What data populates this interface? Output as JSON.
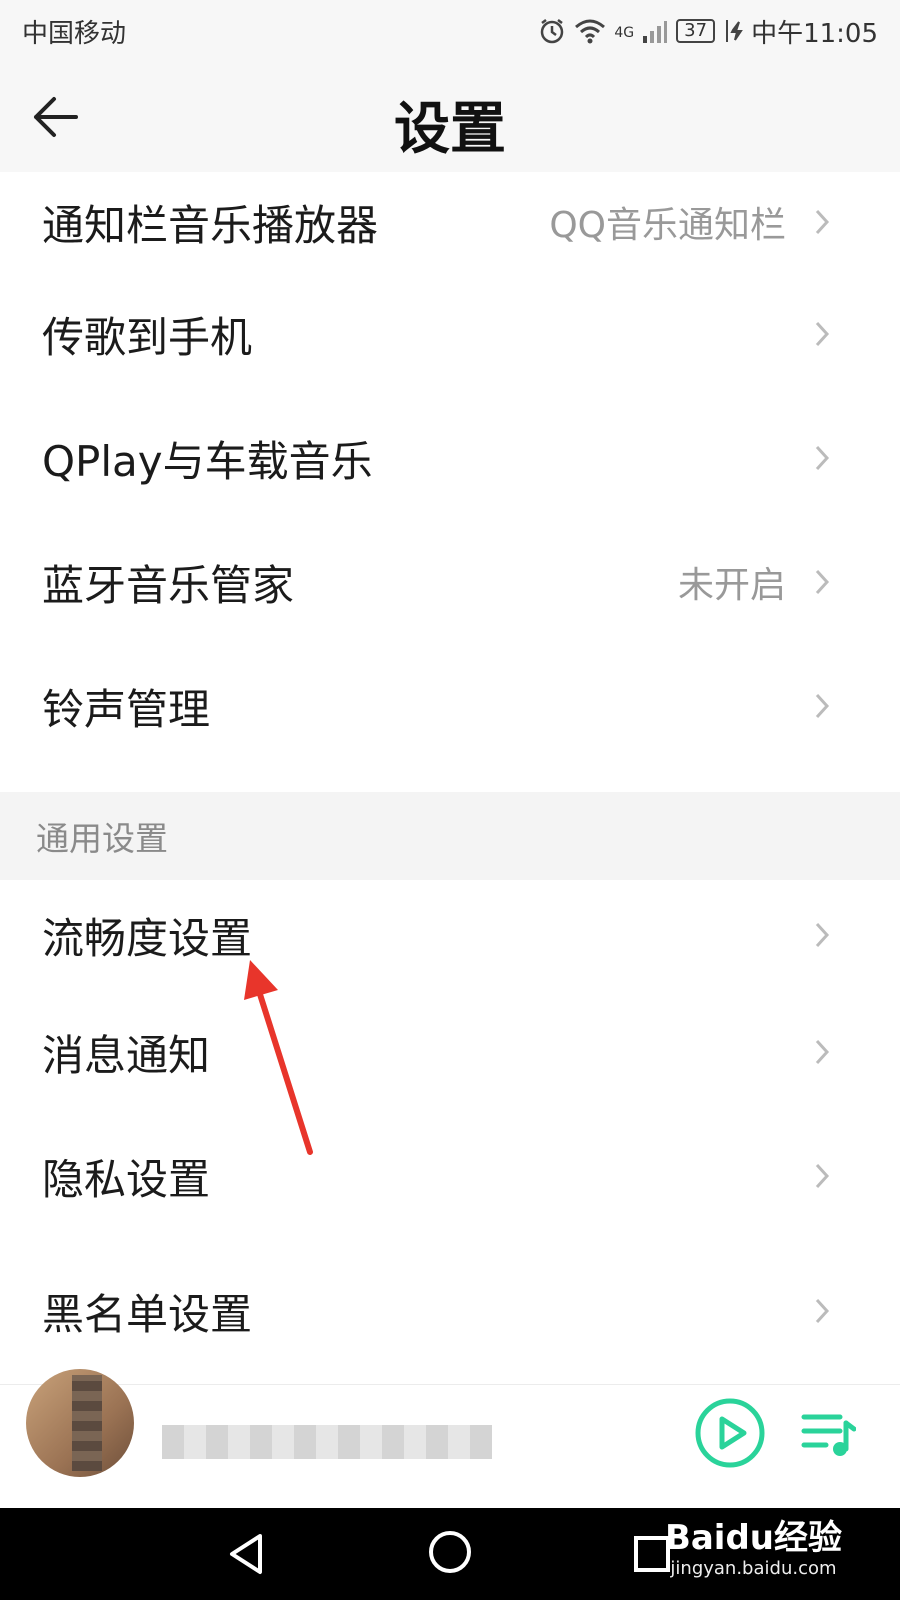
{
  "status_bar": {
    "carrier": "中国移动",
    "network": "4G",
    "battery": "37",
    "time": "中午11:05"
  },
  "header": {
    "title": "设置",
    "back_icon": "back-arrow-icon"
  },
  "list_top": [
    {
      "label": "通知栏音乐播放器",
      "value": "QQ音乐通知栏"
    },
    {
      "label": "传歌到手机",
      "value": ""
    },
    {
      "label": "QPlay与车载音乐",
      "value": ""
    },
    {
      "label": "蓝牙音乐管家",
      "value": "未开启"
    },
    {
      "label": "铃声管理",
      "value": ""
    }
  ],
  "section_general": {
    "title": "通用设置"
  },
  "list_general": [
    {
      "label": "流畅度设置"
    },
    {
      "label": "消息通知"
    },
    {
      "label": "隐私设置"
    },
    {
      "label": "黑名单设置"
    }
  ],
  "player": {
    "play_icon": "play-circle-icon",
    "playlist_icon": "playlist-icon"
  },
  "watermark": {
    "brand": "Baidu经验",
    "url": "jingyan.baidu.com"
  },
  "colors": {
    "accent": "#2ad39a",
    "annotation_arrow": "#e8352b"
  }
}
